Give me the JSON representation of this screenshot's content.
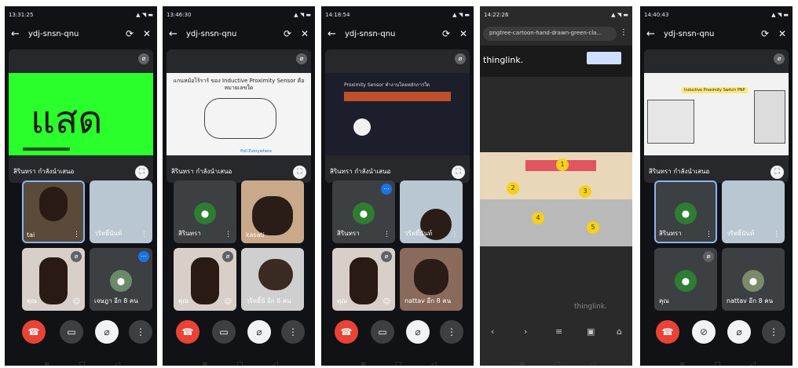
{
  "meeting_title": "ydj-snsn-qnu",
  "presenter_label": "สิรินทรา กำลังนำเสนอ",
  "phones": [
    {
      "status_time": "13:31:25",
      "slide_text": "แสด",
      "tiles": [
        {
          "name": "tai"
        },
        {
          "name": "วริทธิ์นันท์"
        },
        {
          "name": "คุณ"
        },
        {
          "name": "เจษฎา อีก 8 คน"
        }
      ]
    },
    {
      "status_time": "13:46:30",
      "slide_title": "แกนหม้อไร้ราร์ ของ Inductive Proximity Sensor คือ หมายเลขใด",
      "slide_footer": "Poll Everywhere",
      "tiles": [
        {
          "name": "สิรินทรา"
        },
        {
          "name": "kasati"
        },
        {
          "name": "คุณ"
        },
        {
          "name": "วริทธิ์นั อีก 8 คน"
        }
      ]
    },
    {
      "status_time": "14:18:54",
      "slide_title": "Proximity Sensor ทำงานโดยหลักการใด",
      "tiles": [
        {
          "name": "สิรินทรา"
        },
        {
          "name": "วริทธิ์นันท์"
        },
        {
          "name": "คุณ"
        },
        {
          "name": "nattav อีก 8 คน"
        }
      ]
    },
    {
      "status_time": "14:22:26",
      "url": "pngtree-cartoon-hand-drawn-green-cla...",
      "brand": "thinglink.",
      "brand_bottom": "thinglink.",
      "numbers": [
        "1",
        "2",
        "3",
        "4",
        "5"
      ]
    },
    {
      "status_time": "14:40:43",
      "slide_title": "Inductive Proximity Switch PNP",
      "tiles": [
        {
          "name": "สิรินทรา"
        },
        {
          "name": "วริทธิ์นันท์"
        },
        {
          "name": "คุณ"
        },
        {
          "name": "nattav อีก 8 คน"
        }
      ]
    }
  ],
  "colors": {
    "end_call": "#ea4335",
    "slide_green": "#2bff2b",
    "tile_bg": "#3c4043",
    "bg": "#111216"
  },
  "icons": {
    "back": "←",
    "flip_camera": "⟳",
    "speaker_off": "🔇",
    "end_call": "☎",
    "camera": "▭",
    "mic_off": "🎙",
    "more": "⋮"
  }
}
